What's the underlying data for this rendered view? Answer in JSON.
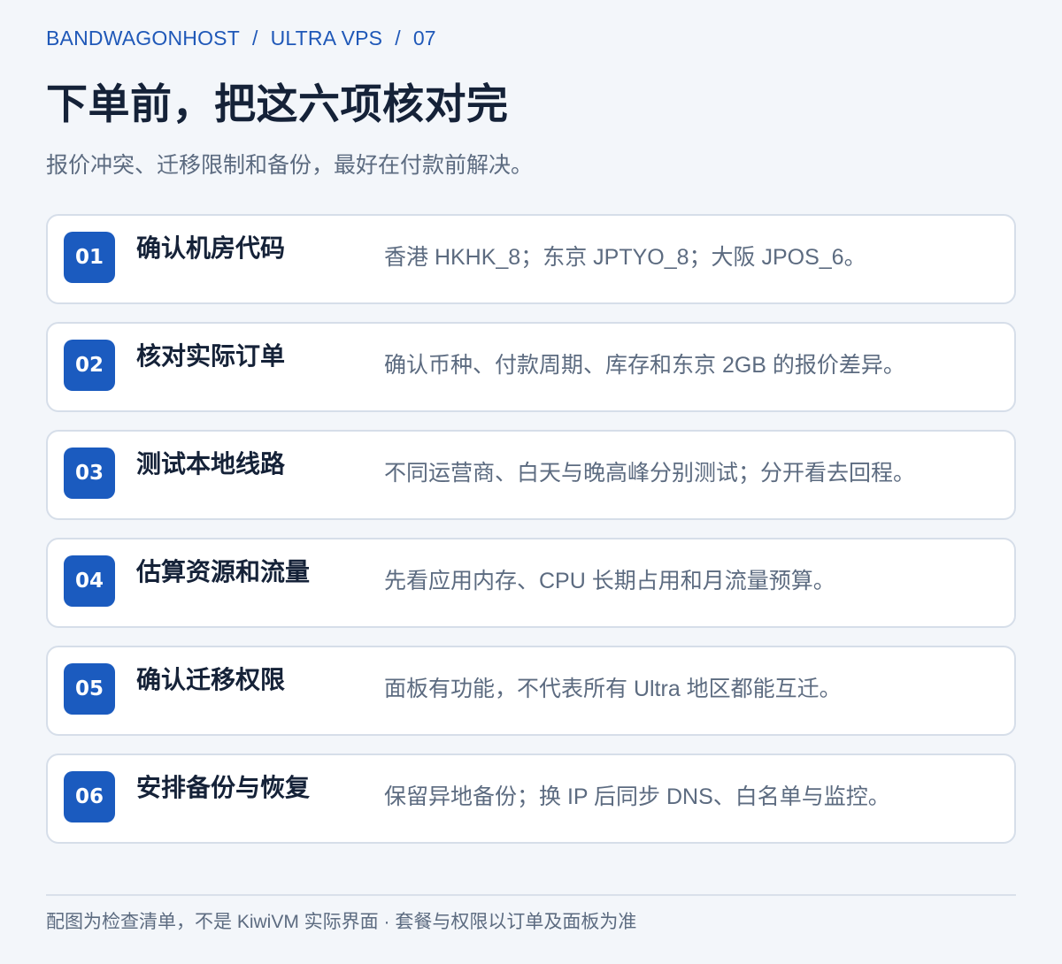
{
  "breadcrumb": {
    "items": [
      "BANDWAGONHOST",
      "ULTRA VPS",
      "07"
    ],
    "separator": "/"
  },
  "title": "下单前，把这六项核对完",
  "subtitle": "报价冲突、迁移限制和备份，最好在付款前解决。",
  "items": [
    {
      "number": "01",
      "title": "确认机房代码",
      "desc": "香港 HKHK_8；东京 JPTYO_8；大阪 JPOS_6。"
    },
    {
      "number": "02",
      "title": "核对实际订单",
      "desc": "确认币种、付款周期、库存和东京 2GB 的报价差异。"
    },
    {
      "number": "03",
      "title": "测试本地线路",
      "desc": "不同运营商、白天与晚高峰分别测试；分开看去回程。"
    },
    {
      "number": "04",
      "title": "估算资源和流量",
      "desc": "先看应用内存、CPU 长期占用和月流量预算。"
    },
    {
      "number": "05",
      "title": "确认迁移权限",
      "desc": "面板有功能，不代表所有 Ultra 地区都能互迁。"
    },
    {
      "number": "06",
      "title": "安排备份与恢复",
      "desc": "保留异地备份；换 IP 后同步 DNS、白名单与监控。"
    }
  ],
  "footer": "配图为检查清单，不是 KiwiVM 实际界面 · 套餐与权限以订单及面板为准",
  "colors": {
    "accent": "#1b5bbf",
    "breadcrumb": "#1f58b8",
    "background": "#f3f6fa",
    "card_border": "#d6dee9",
    "text_dark": "#152238",
    "text_muted": "#5c6b80"
  }
}
